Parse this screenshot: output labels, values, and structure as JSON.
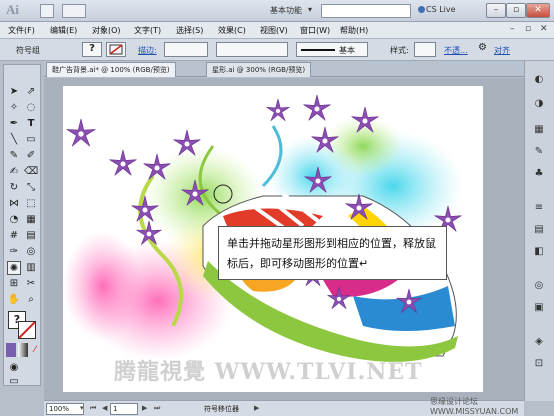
{
  "titlebar": {
    "logo": "Ai",
    "workspace": "基本功能",
    "cs_live": "CS Live",
    "minimize": "–",
    "restore": "▫",
    "close": "✕"
  },
  "menu": {
    "items": [
      "文件(F)",
      "编辑(E)",
      "对象(O)",
      "文字(T)",
      "选择(S)",
      "效果(C)",
      "视图(V)",
      "窗口(W)",
      "帮助(H)"
    ],
    "controls": [
      "–",
      "▫",
      "✕"
    ]
  },
  "controlbar": {
    "selection_label": "符号组",
    "stroke_label": "描边:",
    "basic_label": "基本",
    "style_label": "样式:",
    "opacity_link": "不透...",
    "align_link": "对齐"
  },
  "tabs": [
    {
      "label": "鞋广告背景.ai* @ 100% (RGB/预览)",
      "active": true
    },
    {
      "label": "星形.ai @ 300% (RGB/预览)",
      "active": false
    }
  ],
  "callout": {
    "text": "单击并拖动星形图形到相应的位置，释放鼠标后，即可移动图形的位置↵"
  },
  "watermarks": {
    "main": "腾龍視覺 WWW.TLVI.NET",
    "corner": "思缘设计论坛 WWW.MISSYUAN.COM"
  },
  "status": {
    "zoom": "100%",
    "page": "1",
    "tool_name": "符号移位器"
  },
  "colors": {
    "flower": "#8a4fb0",
    "flower_center": "#ffffff",
    "accent": "#1f4fb3"
  }
}
